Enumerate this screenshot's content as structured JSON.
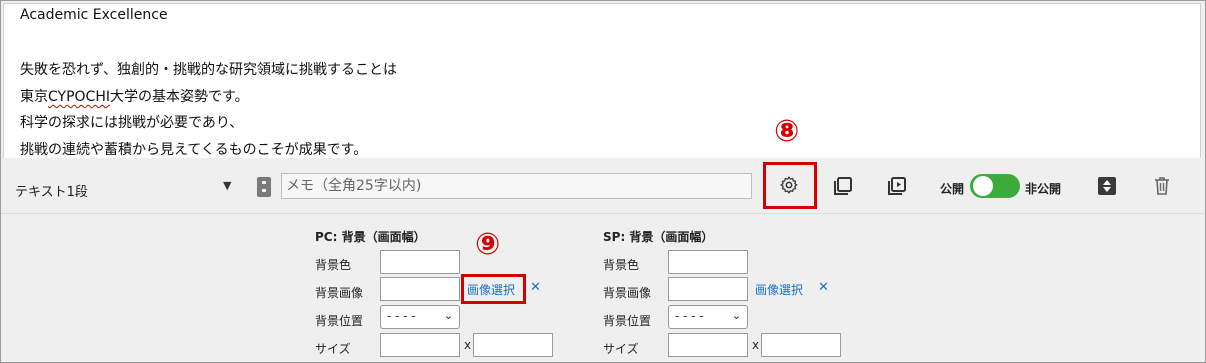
{
  "editor": {
    "lines": [
      "Academic Excellence",
      "失敗を恐れず、独創的・挑戦的な研究領域に挑戦することは",
      "東京",
      "CYPOCHI",
      "大学の基本姿勢です。",
      "科学の探求には挑戦が必要であり、",
      "挑戦の連続や蓄積から見えてくるものこそが成果です。"
    ]
  },
  "toolbar": {
    "block_type": "テキスト1段",
    "memo_placeholder": "メモ（全角25字以内)",
    "public_label": "公開",
    "private_label": "非公開",
    "toggle_on": true
  },
  "markers": {
    "gear": "⑧",
    "image_select": "⑨"
  },
  "pc": {
    "title": "PC: 背景（画面幅）",
    "bg_color_label": "背景色",
    "bg_image_label": "背景画像",
    "image_select_label": "画像選択",
    "clear_label": "✕",
    "bg_position_label": "背景位置",
    "bg_position_value": "- - - -",
    "size_label": "サイズ",
    "size_separator": "x"
  },
  "sp": {
    "title": "SP: 背景（画面幅）",
    "bg_color_label": "背景色",
    "bg_image_label": "背景画像",
    "image_select_label": "画像選択",
    "clear_label": "✕",
    "bg_position_label": "背景位置",
    "bg_position_value": "- - - -",
    "size_label": "サイズ",
    "size_separator": "x"
  },
  "colors": {
    "highlight": "#d40000",
    "toggle": "#3cab3c",
    "link": "#1a6fc9"
  }
}
